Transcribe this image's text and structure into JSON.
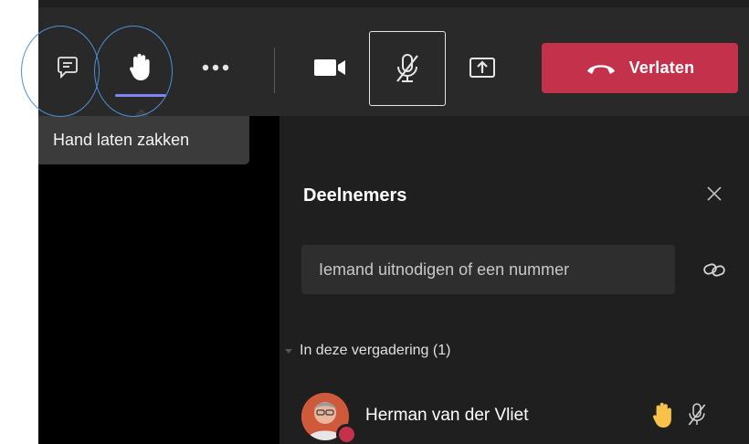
{
  "toolbar": {
    "tooltip": "Hand laten zakken",
    "leave_label": "Verlaten",
    "leave_color": "#c4314b",
    "icons": [
      "chat-icon",
      "raise-hand-icon",
      "more-options-icon",
      "camera-icon",
      "mic-off-icon",
      "share-screen-icon",
      "hang-up-icon"
    ]
  },
  "panel": {
    "title": "Deelnemers",
    "invite_placeholder": "Iemand uitnodigen of een nummer",
    "section_label": "In deze vergadering (1)",
    "participants": [
      {
        "name": "Herman van der Vliet",
        "hand_raised": true,
        "muted": true
      }
    ]
  }
}
